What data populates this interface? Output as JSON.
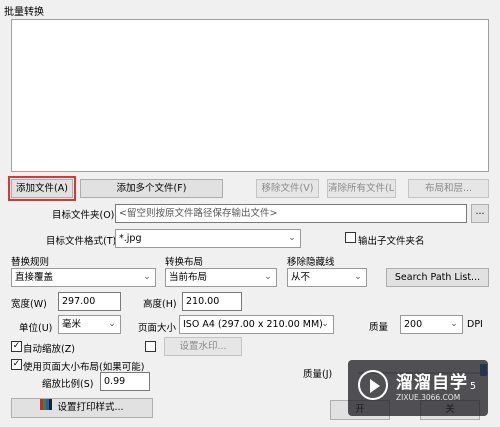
{
  "window": {
    "title": "批量转换"
  },
  "file_list": {
    "items": []
  },
  "buttons": {
    "add_file": "添加文件(A)",
    "add_multiple_files": "添加多个文件(F)",
    "remove_file": "移除文件(V)",
    "clear_all_files": "清除所有文件(L)",
    "layout_layers": "布局和层...",
    "browse_folder": "...",
    "search_path_list": "Search Path List...",
    "set_watermark": "设置水印...",
    "print_style": "设置打印样式...",
    "start": "开",
    "close": "关"
  },
  "target_folder": {
    "label": "目标文件夹(O)",
    "placeholder": "<留空则按原文件路径保存输出文件>"
  },
  "target_format": {
    "label": "目标文件格式(T)",
    "value": "*.jpg"
  },
  "output_subfolder": {
    "label": "输出子文件夹名",
    "checked": false
  },
  "replace_rule": {
    "label": "替换规则",
    "value": "直接覆盖"
  },
  "convert_layout": {
    "label": "转换布局",
    "value": "当前布局"
  },
  "remove_hidden_lines": {
    "label": "移除隐藏线",
    "value": "从不"
  },
  "width": {
    "label": "宽度(W)",
    "value": "297.00"
  },
  "height": {
    "label": "高度(H)",
    "value": "210.00"
  },
  "unit": {
    "label": "单位(U)",
    "value": "毫米"
  },
  "page_size": {
    "label": "页面大小",
    "value": "ISO A4 (297.00 x 210.00 MM)"
  },
  "quality_dpi": {
    "label": "质量",
    "value": "200",
    "unit": "DPI"
  },
  "auto_zoom": {
    "label": "自动缩放(Z)",
    "checked": true
  },
  "watermark_enable": {
    "checked": false
  },
  "use_page_size_layout": {
    "label": "使用页面大小布局(如果可能)",
    "checked": true
  },
  "zoom_ratio": {
    "label": "缩放比例(S)",
    "value": "0.99"
  },
  "quality_j": {
    "label": "质量(J)"
  },
  "brand_watermark": {
    "big": "溜溜自学",
    "small": "ZIXUE.3066.COM",
    "partial_digit": "5"
  },
  "colors": {
    "highlight": "#e0352f",
    "slider": "#1e7ad8"
  }
}
